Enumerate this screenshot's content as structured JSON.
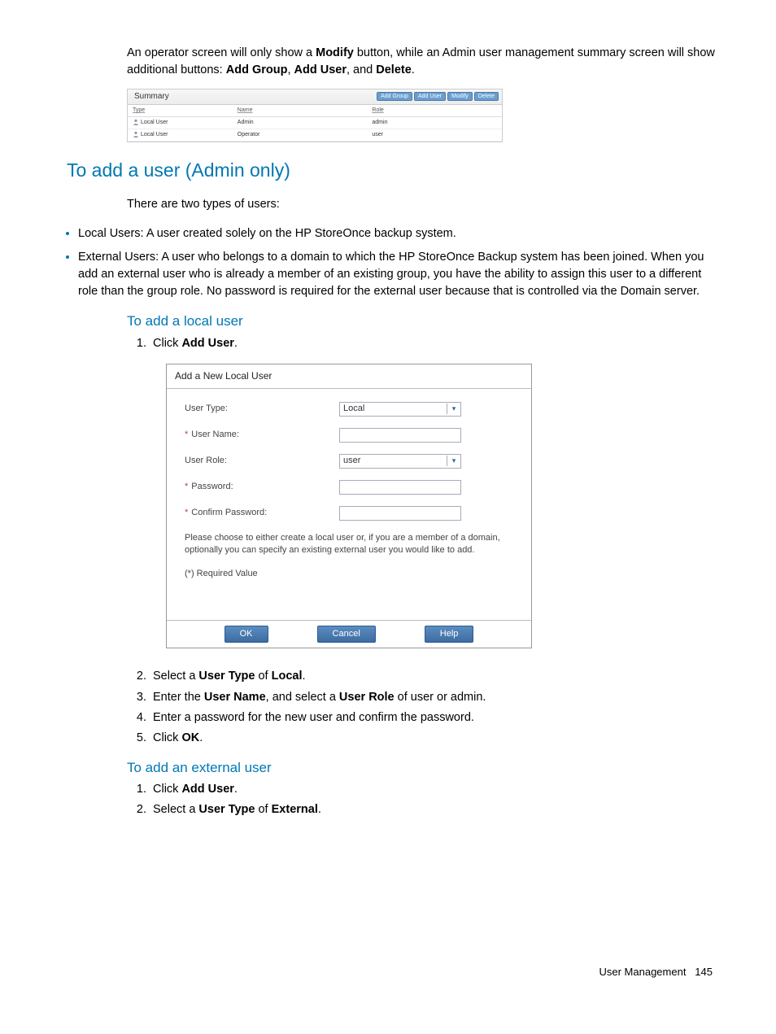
{
  "intro": {
    "p1a": "An operator screen will only show a ",
    "p1b_bold": "Modify",
    "p1c": " button, while an Admin user management summary screen will show additional buttons: ",
    "p1d_bold": "Add Group",
    "p1e": ", ",
    "p1f_bold": "Add User",
    "p1g": ", and ",
    "p1h_bold": "Delete",
    "p1i": "."
  },
  "summary": {
    "title": "Summary",
    "buttons": {
      "addGroup": "Add Group",
      "addUser": "Add User",
      "modify": "Modify",
      "delete": "Delete"
    },
    "headers": {
      "type": "Type",
      "name": "Name",
      "role": "Role"
    },
    "rows": [
      {
        "type": "Local User",
        "name": "Admin",
        "role": "admin"
      },
      {
        "type": "Local User",
        "name": "Operator",
        "role": "user"
      }
    ]
  },
  "section1": {
    "heading": "To add a user (Admin only)",
    "intro": "There are two types of users:",
    "bullet1": "Local Users: A user created solely on the HP StoreOnce backup system.",
    "bullet2": "External Users: A user who belongs to a domain to which the HP StoreOnce Backup system has been joined. When you add an external user who is already a member of an existing group, you have the ability to assign this user to a different role than the group role. No password is required for the external user because that is controlled via the Domain server."
  },
  "localUser": {
    "heading": "To add a local user",
    "step1a": "Click ",
    "step1b_bold": "Add User",
    "step1c": ".",
    "step2a": "Select a ",
    "step2b_bold": "User Type",
    "step2c": " of ",
    "step2d_bold": "Local",
    "step2e": ".",
    "step3a": "Enter the ",
    "step3b_bold": "User Name",
    "step3c": ", and select a ",
    "step3d_bold": "User Role",
    "step3e": " of user or admin.",
    "step4": "Enter a password for the new user and confirm the password.",
    "step5a": "Click ",
    "step5b_bold": "OK",
    "step5c": "."
  },
  "dialog": {
    "title": "Add a New Local User",
    "labels": {
      "userType": "User Type:",
      "userName": "User Name:",
      "userRole": "User Role:",
      "password": "Password:",
      "confirm": "Confirm Password:"
    },
    "values": {
      "userType": "Local",
      "userRole": "user"
    },
    "hint": "Please choose to either create a local user or, if you are a member of a domain, optionally you can specify an existing external user you would like to add.",
    "required": "(*) Required Value",
    "buttons": {
      "ok": "OK",
      "cancel": "Cancel",
      "help": "Help"
    }
  },
  "externalUser": {
    "heading": "To add an external user",
    "step1a": "Click ",
    "step1b_bold": "Add User",
    "step1c": ".",
    "step2a": "Select a ",
    "step2b_bold": "User Type",
    "step2c": " of ",
    "step2d_bold": "External",
    "step2e": "."
  },
  "footer": {
    "label": "User Management",
    "page": "145"
  }
}
